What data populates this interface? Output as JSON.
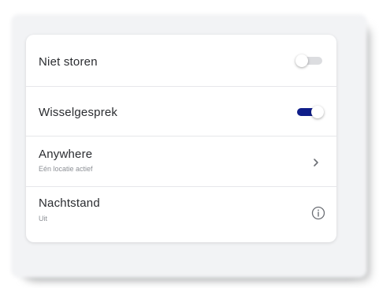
{
  "settings": {
    "items": [
      {
        "label": "Niet storen",
        "control": "toggle",
        "state": "off"
      },
      {
        "label": "Wisselgesprek",
        "control": "toggle",
        "state": "on"
      },
      {
        "label": "Anywhere",
        "sublabel": "Eén locatie actief",
        "control": "chevron-right-icon"
      },
      {
        "label": "Nachtstand",
        "sublabel": "Uit",
        "control": "info-icon"
      }
    ]
  },
  "colors": {
    "toggle_on": "#0f1e8a",
    "toggle_off": "#dcdde0",
    "text_primary": "#2a2c30",
    "text_secondary": "#8d9096"
  }
}
